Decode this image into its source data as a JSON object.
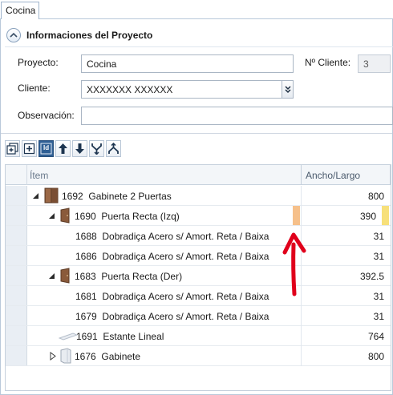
{
  "tab": {
    "label": "Cocina"
  },
  "section": {
    "title": "Informaciones del Proyecto"
  },
  "form": {
    "proyecto_label": "Proyecto:",
    "proyecto_value": "Cocina",
    "n_cliente_label": "Nº Cliente:",
    "n_cliente_value": "3",
    "cliente_label": "Cliente:",
    "cliente_value": "XXXXXXX XXXXXX",
    "observacion_label": "Observación:",
    "observacion_value": ""
  },
  "toolbar": {
    "buttons": [
      "expand-all-icon",
      "add-icon",
      "id-icon",
      "arrow-up-icon",
      "arrow-down-icon",
      "merge-icon",
      "split-icon"
    ],
    "id_label": "Id"
  },
  "grid": {
    "columns": {
      "item": "Ítem",
      "size": "Ancho/Largo"
    },
    "rows": [
      {
        "id": "1692",
        "name": "Gabinete 2 Puertas",
        "value": "800",
        "level": 0,
        "expander": "open",
        "icon": "cabinet-double-door-icon"
      },
      {
        "id": "1690",
        "name": "Puerta Recta (Izq)",
        "value": "390",
        "level": 1,
        "expander": "open",
        "icon": "door-icon",
        "marks": true
      },
      {
        "id": "1688",
        "name": "Dobradiça Acero s/ Amort. Reta / Baixa",
        "value": "31",
        "level": 2,
        "expander": "none",
        "icon": ""
      },
      {
        "id": "1686",
        "name": "Dobradiça Acero s/ Amort. Reta / Baixa",
        "value": "31",
        "level": 2,
        "expander": "none",
        "icon": ""
      },
      {
        "id": "1683",
        "name": "Puerta Recta (Der)",
        "value": "392.5",
        "level": 1,
        "expander": "open",
        "icon": "door-icon"
      },
      {
        "id": "1681",
        "name": "Dobradiça Acero s/ Amort. Reta / Baixa",
        "value": "31",
        "level": 2,
        "expander": "none",
        "icon": ""
      },
      {
        "id": "1679",
        "name": "Dobradiça Acero s/ Amort. Reta / Baixa",
        "value": "31",
        "level": 2,
        "expander": "none",
        "icon": ""
      },
      {
        "id": "1691",
        "name": "Estante Lineal",
        "value": "764",
        "level": 1,
        "expander": "none",
        "icon": "shelf-icon"
      },
      {
        "id": "1676",
        "name": "Gabinete",
        "value": "800",
        "level": 1,
        "expander": "closed",
        "icon": "cabinet-icon"
      }
    ]
  },
  "colors": {
    "accent": "#2f5f94",
    "mark_orange": "#f6c08a",
    "mark_yellow": "#f7e07a",
    "annotation_arrow": "#e0001b"
  },
  "annotation": {
    "icon": "red-arrow-up-icon"
  }
}
